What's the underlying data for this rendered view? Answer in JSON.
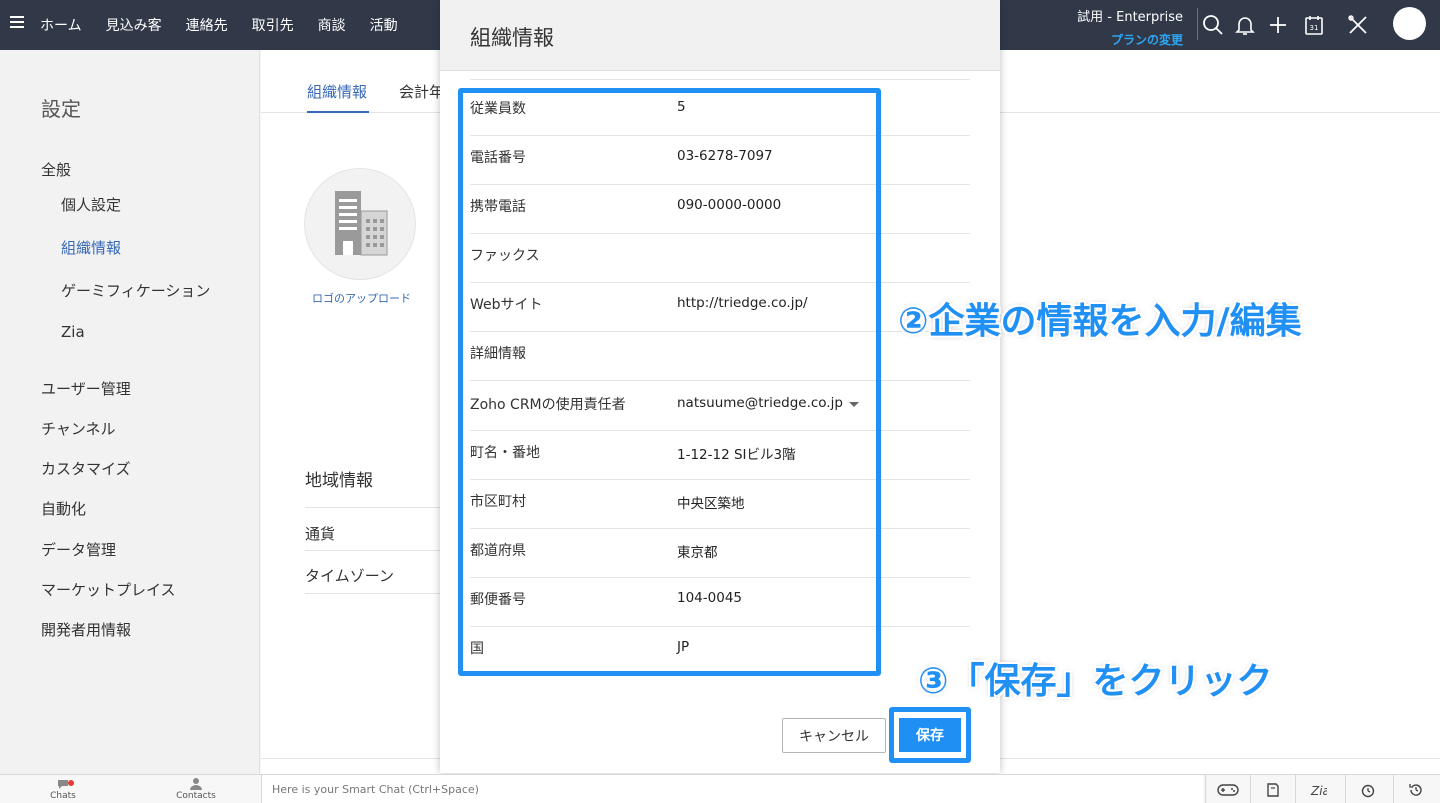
{
  "topbar": {
    "nav": [
      "ホーム",
      "見込み客",
      "連絡先",
      "取引先",
      "商談",
      "活動"
    ],
    "trial_label": "試用 - Enterprise",
    "upgrade_label": "プランの変更"
  },
  "sidebar": {
    "title": "設定",
    "general": "全般",
    "sub_items": [
      "個人設定",
      "組織情報",
      "ゲーミフィケーション",
      "Zia"
    ],
    "items": [
      "ユーザー管理",
      "チャンネル",
      "カスタマイズ",
      "自動化",
      "データ管理",
      "マーケットプレイス",
      "開発者用情報"
    ]
  },
  "main": {
    "tabs": [
      "組織情報",
      "会計年"
    ],
    "logo_upload": "ロゴのアップロード",
    "region_title": "地域情報",
    "region_rows": [
      "通貨",
      "タイムゾーン"
    ]
  },
  "modal": {
    "title": "組織情報",
    "fields": [
      {
        "label": "従業員数",
        "value": "5"
      },
      {
        "label": "電話番号",
        "value": "03-6278-7097"
      },
      {
        "label": "携帯電話",
        "value": "090-0000-0000"
      },
      {
        "label": "ファックス",
        "value": ""
      },
      {
        "label": "Webサイト",
        "value": "http://triedge.co.jp/"
      },
      {
        "label": "詳細情報",
        "value": ""
      },
      {
        "label": "Zoho CRMの使用責任者",
        "value": "natsuume@triedge.co.jp"
      },
      {
        "label": "町名・番地",
        "value": "1-12-12 SIビル3階"
      },
      {
        "label": "市区町村",
        "value": "中央区築地"
      },
      {
        "label": "都道府県",
        "value": "東京都"
      },
      {
        "label": "郵便番号",
        "value": "104-0045"
      },
      {
        "label": "国",
        "value": "JP"
      }
    ],
    "cancel_label": "キャンセル",
    "save_label": "保存"
  },
  "annotations": {
    "step2": "②企業の情報を入力/編集",
    "step3": "③「保存」をクリック"
  },
  "bottombar": {
    "chats": "Chats",
    "contacts": "Contacts",
    "smart_chat": "Here is your Smart Chat (Ctrl+Space)"
  },
  "colors": {
    "topbar": "#313949",
    "accent": "#2190f5",
    "link": "#3768b5"
  }
}
